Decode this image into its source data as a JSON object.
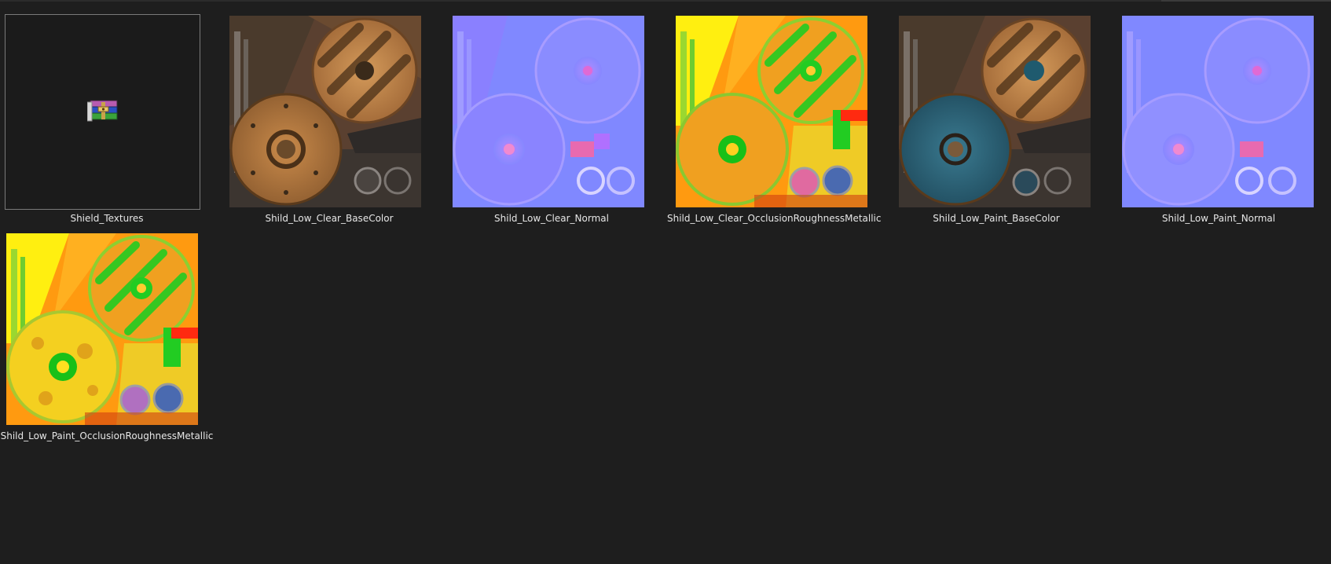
{
  "files": [
    {
      "name": "Shield_Textures",
      "kind": "archive",
      "icon": "winrar-archive-icon",
      "selected": true
    },
    {
      "name": "Shild_Low_Clear_BaseColor",
      "kind": "texture",
      "style": "basecolor-clear"
    },
    {
      "name": "Shild_Low_Clear_Normal",
      "kind": "texture",
      "style": "normal"
    },
    {
      "name": "Shild_Low_Clear_OcclusionRoughnessMetallic",
      "kind": "texture",
      "style": "orm"
    },
    {
      "name": "Shild_Low_Paint_BaseColor",
      "kind": "texture",
      "style": "basecolor-paint"
    },
    {
      "name": "Shild_Low_Paint_Normal",
      "kind": "texture",
      "style": "normal"
    },
    {
      "name": "Shild_Low_Paint_OcclusionRoughnessMetallic",
      "kind": "texture",
      "style": "orm-paint"
    }
  ],
  "colors": {
    "background": "#1e1e1e",
    "label_text": "#e6e6e6",
    "selection_border": "#7a7a7a"
  }
}
